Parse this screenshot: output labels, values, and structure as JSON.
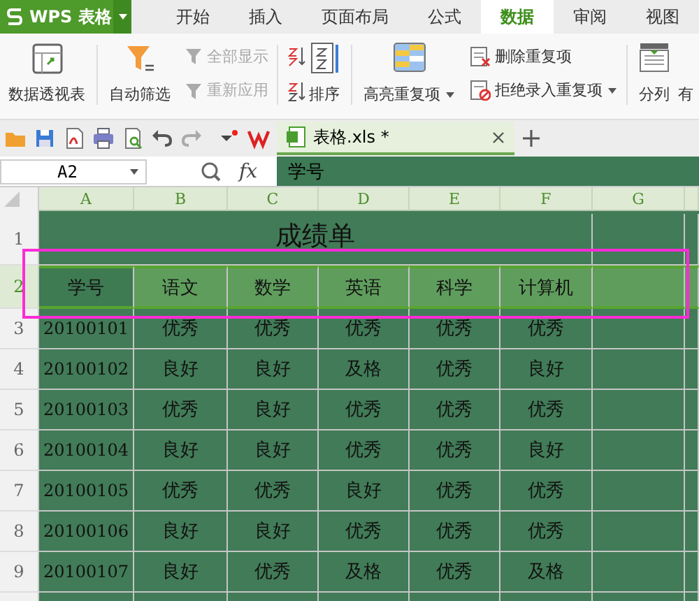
{
  "app": {
    "logo": "WPS 表格"
  },
  "menu_tabs": [
    {
      "label": "开始",
      "selected": false
    },
    {
      "label": "插入",
      "selected": false
    },
    {
      "label": "页面布局",
      "selected": false
    },
    {
      "label": "公式",
      "selected": false
    },
    {
      "label": "数据",
      "selected": true
    },
    {
      "label": "审阅",
      "selected": false
    },
    {
      "label": "视图",
      "selected": false
    }
  ],
  "ribbon": {
    "pivot": "数据透视表",
    "autofilter": "自动筛选",
    "show_all": {
      "label": "全部显示",
      "disabled": true
    },
    "reapply": {
      "label": "重新应用",
      "disabled": true
    },
    "sort": "排序",
    "highlight_dupes": "高亮重复项",
    "remove_dupes": "删除重复项",
    "reject_dupes": "拒绝录入重复项",
    "split": "分列",
    "next_item": "有"
  },
  "doc_tab": {
    "title": "表格.xls *",
    "selected": true
  },
  "formula_bar": {
    "name_box": "A2",
    "fx": "fx",
    "content": "学号"
  },
  "sheet": {
    "columns": [
      "A",
      "B",
      "C",
      "D",
      "E",
      "F",
      "G"
    ],
    "rows": [
      {
        "number": "1",
        "kind": "title",
        "selected": false,
        "title": "成绩单"
      },
      {
        "number": "2",
        "kind": "header",
        "selected": true,
        "cells": [
          {
            "text": "学号",
            "active": true
          },
          {
            "text": "语文",
            "active": false
          },
          {
            "text": "数学",
            "active": false
          },
          {
            "text": "英语",
            "active": false
          },
          {
            "text": "科学",
            "active": false
          },
          {
            "text": "计算机",
            "active": false
          }
        ]
      },
      {
        "number": "3",
        "kind": "data",
        "selected": false,
        "cells": [
          "20100101",
          "优秀",
          "优秀",
          "优秀",
          "优秀",
          "优秀"
        ]
      },
      {
        "number": "4",
        "kind": "data",
        "selected": false,
        "cells": [
          "20100102",
          "良好",
          "良好",
          "及格",
          "优秀",
          "良好"
        ]
      },
      {
        "number": "5",
        "kind": "data",
        "selected": false,
        "cells": [
          "20100103",
          "优秀",
          "良好",
          "优秀",
          "优秀",
          "优秀"
        ]
      },
      {
        "number": "6",
        "kind": "data",
        "selected": false,
        "cells": [
          "20100104",
          "良好",
          "良好",
          "优秀",
          "优秀",
          "良好"
        ]
      },
      {
        "number": "7",
        "kind": "data",
        "selected": false,
        "cells": [
          "20100105",
          "优秀",
          "优秀",
          "良好",
          "优秀",
          "优秀"
        ]
      },
      {
        "number": "8",
        "kind": "data",
        "selected": false,
        "cells": [
          "20100106",
          "良好",
          "良好",
          "优秀",
          "优秀",
          "优秀"
        ]
      },
      {
        "number": "9",
        "kind": "data",
        "selected": false,
        "cells": [
          "20100107",
          "良好",
          "优秀",
          "及格",
          "优秀",
          "及格"
        ]
      }
    ]
  }
}
